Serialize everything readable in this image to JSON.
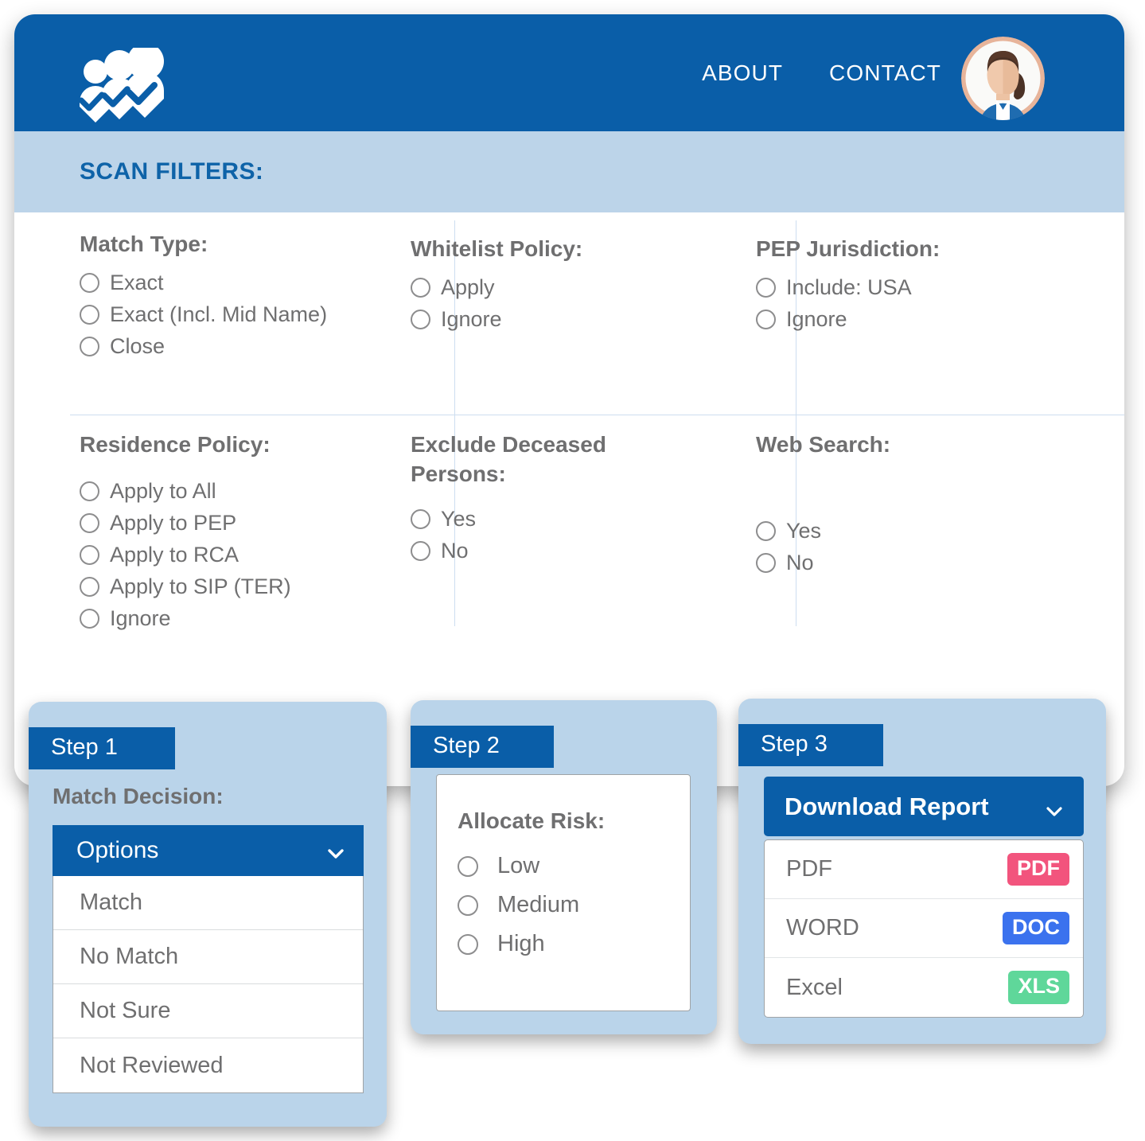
{
  "brand": {
    "logo_icon": "people-check-logo-icon",
    "header_bg": "#0A5EA8",
    "subheader_bg": "#BCD4E9",
    "accent": "#0E63A8",
    "card_bg": "#BAD4EA",
    "text_gray": "#6F6F70"
  },
  "header": {
    "nav": [
      {
        "label": "ABOUT"
      },
      {
        "label": "CONTACT"
      }
    ],
    "avatar_alt": "user-avatar"
  },
  "subheader": {
    "title": "SCAN FILTERS:"
  },
  "filters": [
    {
      "id": "match-type",
      "label": "Match Type:",
      "options": [
        "Exact",
        "Exact (Incl. Mid Name)",
        "Close"
      ]
    },
    {
      "id": "whitelist-policy",
      "label": "Whitelist Policy:",
      "options": [
        "Apply",
        "Ignore"
      ]
    },
    {
      "id": "pep-jurisdiction",
      "label": "PEP Jurisdiction:",
      "options": [
        "Include: USA",
        "Ignore"
      ]
    },
    {
      "id": "residence-policy",
      "label": "Residence Policy:",
      "options": [
        "Apply to All",
        "Apply to PEP",
        "Apply to RCA",
        "Apply to SIP (TER)",
        "Ignore"
      ]
    },
    {
      "id": "exclude-deceased-persons",
      "label": "Exclude Deceased Persons:",
      "options": [
        "Yes",
        "No"
      ]
    },
    {
      "id": "web-search",
      "label": "Web Search:",
      "options": [
        "Yes",
        "No"
      ]
    }
  ],
  "steps": {
    "step1": {
      "badge": "Step 1",
      "sublabel": "Match Decision:",
      "dropdown": {
        "selected": "Options",
        "chevron_icon": "chevron-down-icon",
        "options": [
          "Match",
          "No Match",
          "Not Sure",
          "Not Reviewed"
        ]
      }
    },
    "step2": {
      "badge": "Step 2",
      "risk": {
        "title": "Allocate Risk:",
        "options": [
          "Low",
          "Medium",
          "High"
        ]
      }
    },
    "step3": {
      "badge": "Step 3",
      "download": {
        "label": "Download Report",
        "chevron_icon": "chevron-down-icon",
        "formats": [
          {
            "name": "PDF",
            "badge": "PDF",
            "color": "#F2547D"
          },
          {
            "name": "WORD",
            "badge": "DOC",
            "color": "#3B72EE"
          },
          {
            "name": "Excel",
            "badge": "XLS",
            "color": "#5FD79A"
          }
        ]
      }
    }
  }
}
